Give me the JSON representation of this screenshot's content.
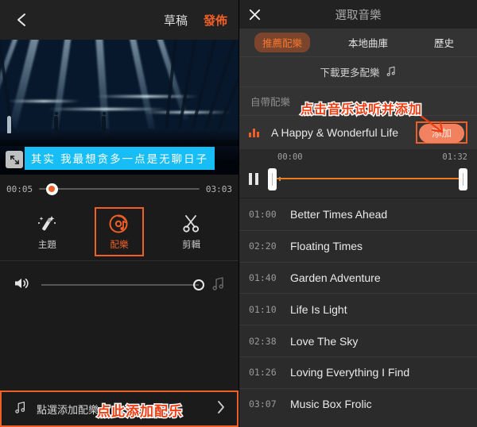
{
  "left": {
    "header": {
      "back_icon": "chevron-left-icon",
      "draft_label": "草稿",
      "publish_label": "發佈"
    },
    "video": {
      "fullscreen_icon": "fullscreen-icon",
      "subtitle": "其实 我最想贪多一点是无聊日子",
      "subtitle_bg": "#17bdf5"
    },
    "timeline": {
      "current_time": "00:05",
      "total_time": "03:03",
      "playhead_color": "#ef5f26",
      "playhead_percent": 8
    },
    "tools": [
      {
        "label": "主題",
        "icon": "magic-wand-icon",
        "selected": false
      },
      {
        "label": "配樂",
        "icon": "music-disc-icon",
        "selected": true
      },
      {
        "label": "剪輯",
        "icon": "scissors-icon",
        "selected": false
      }
    ],
    "volume": {
      "speaker_icon": "speaker-icon",
      "music_note_icon": "music-note-icon",
      "level_percent": 100
    },
    "add_music_bar": {
      "icon": "music-note-icon",
      "label": "點選添加配樂",
      "chevron_icon": "chevron-right-icon"
    }
  },
  "right": {
    "header": {
      "close_icon": "close-x-icon",
      "title": "選取音樂"
    },
    "tabs": [
      {
        "label": "推薦配樂",
        "active": true
      },
      {
        "label": "本地曲庫",
        "active": false
      },
      {
        "label": "歷史",
        "active": false
      }
    ],
    "download_row": {
      "label": "下載更多配樂",
      "icon": "music-note-icon"
    },
    "section_label": "自帶配樂",
    "current_track": {
      "playing_icon": "equalizer-icon",
      "name": "A Happy & Wonderful Life",
      "add_label": "添加"
    },
    "trim": {
      "pause_icon": "pause-icon",
      "start_time": "00:00",
      "end_time": "01:32",
      "track_color": "#ef7a1f"
    },
    "tracks": [
      {
        "duration": "01:00",
        "name": "Better Times Ahead"
      },
      {
        "duration": "02:20",
        "name": "Floating Times"
      },
      {
        "duration": "01:40",
        "name": "Garden Adventure"
      },
      {
        "duration": "01:10",
        "name": "Life Is Light"
      },
      {
        "duration": "02:38",
        "name": "Love The Sky"
      },
      {
        "duration": "01:26",
        "name": "Loving Everything I Find"
      },
      {
        "duration": "03:07",
        "name": "Music Box Frolic"
      }
    ]
  },
  "annotations": {
    "right_panel": "点击音乐试听并添加",
    "bottom_bar": "点此添加配乐",
    "color": "#f03d12"
  }
}
